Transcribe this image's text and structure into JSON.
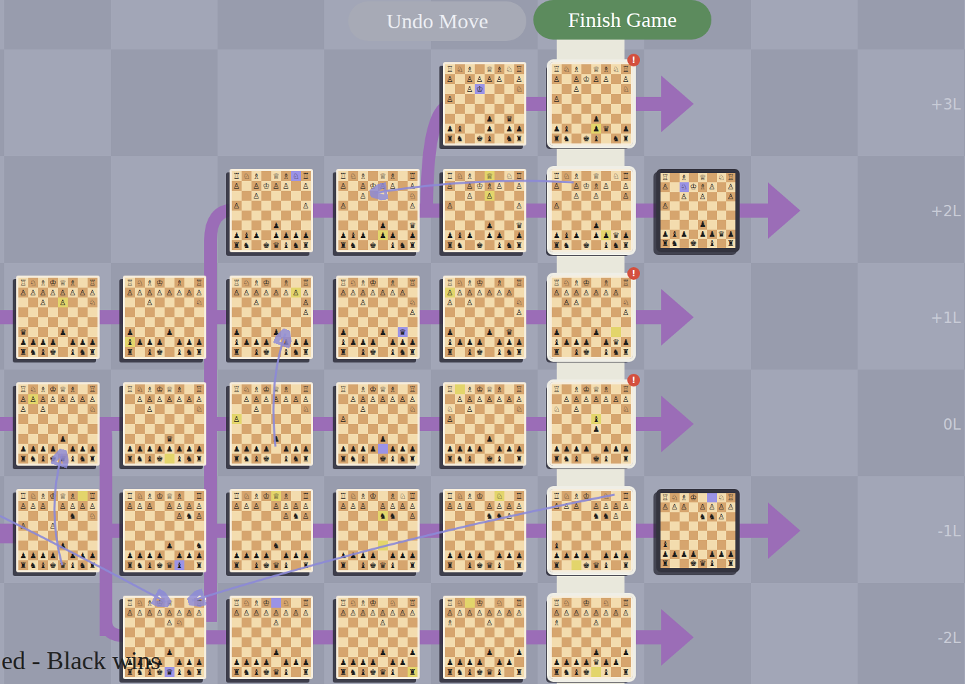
{
  "buttons": [
    {
      "label": "Undo Move",
      "disabled": true
    },
    {
      "label": "Finish Game",
      "disabled": false
    }
  ],
  "result": "ed - Black wins",
  "alert_glyph": "!",
  "timelines": [
    {
      "label": "+3L",
      "boards": [
        null,
        null,
        null,
        null,
        {
          "side": "white",
          "present": false,
          "alert": false,
          "rows": [
            "♖♘♗ ♕♗♘♖",
            "♙ ♙♙♙♙ ♙",
            "  ♙♔   ♘",
            "♙       ",
            "        ",
            "    ♟ ♛ ",
            "♟♝  ♟ ♟♟",
            "♜♞ ♚♝ ♞♜"
          ],
          "marks": [
            {
              "square": [
                2,
                3
              ],
              "color": "#9b93e6"
            }
          ]
        },
        {
          "side": "white",
          "present": true,
          "alert": true,
          "rows": [
            "♖♘♗ ♕♗♘♖",
            "♙ ♙♔♙♙ ♙",
            "  ♙    ♘",
            "♙       ",
            "        ",
            "    ♟   ",
            "♟♝  ♟♛ ♟",
            "♜♞ ♚♝ ♞♜"
          ],
          "marks": [
            {
              "square": [
                6,
                4
              ],
              "color": "#e3d56b"
            }
          ]
        }
      ]
    },
    {
      "label": "+2L",
      "boards": [
        null,
        null,
        {
          "side": "white",
          "present": false,
          "alert": false,
          "rows": [
            "♖♘♗ ♕♗♘♖",
            "♙ ♙♔♙♙ ♙",
            "  ♙     ",
            "♙      ♙",
            "        ",
            "    ♟   ",
            "♟♝♟ ♟♟♟♟",
            "♜♞ ♚♛♝♞♜"
          ],
          "marks": [
            {
              "square": [
                0,
                6
              ],
              "color": "#9b93e6"
            }
          ]
        },
        {
          "side": "white",
          "present": false,
          "alert": false,
          "rows": [
            "♖♘♗ ♕♗ ♖",
            "♙ ♙♔♙♙ ♙",
            "  ♙    ♘",
            "♙      ♙",
            "        ",
            "    ♟  ♛",
            "♟♝♟ ♟♟ ♟",
            "♜♞ ♚ ♝♞♜"
          ],
          "marks": [
            {
              "square": [
                6,
                4
              ],
              "color": "#e3d56b"
            }
          ]
        },
        {
          "side": "white",
          "present": false,
          "alert": false,
          "rows": [
            "♖♘♗ ♕ ♘♖",
            "♙ ♙♔♗♙ ♙",
            "  ♙ ♙   ",
            "♙      ♙",
            "        ",
            "    ♟  ♛",
            "♟♝♟ ♟♟ ♟",
            "♜♞ ♚ ♝♞♜"
          ],
          "marks": [
            {
              "square": [
                0,
                4
              ],
              "color": "#e3d56b"
            },
            {
              "square": [
                2,
                4
              ],
              "color": "#e3d56b"
            }
          ]
        },
        {
          "side": "white",
          "present": true,
          "alert": false,
          "rows": [
            "♖♘♗ ♕ ♘♖",
            "♙ ♙♔♗♙ ♙",
            "  ♙ ♙  ♙",
            "♙       ",
            "        ",
            "    ♟   ",
            "♟♝♟ ♟♟♛♟",
            "♜♞ ♚ ♝♞♜"
          ],
          "marks": [
            {
              "square": [
                6,
                5
              ],
              "color": "#e3d56b"
            }
          ]
        },
        {
          "side": "black",
          "present": false,
          "alert": false,
          "rows": [
            "♖ ♗ ♕ ♘♖",
            "♙ ♘♔♗♙ ♙",
            "  ♙ ♙  ♙",
            "♙       ",
            "        ",
            "    ♟   ",
            "♟♝♟ ♟♟♛♟",
            "♜♞ ♚ ♝ ♜"
          ],
          "marks": [
            {
              "square": [
                1,
                2
              ],
              "color": "#9b93e6"
            }
          ]
        }
      ]
    },
    {
      "label": "+1L",
      "boards": [
        {
          "side": "white",
          "present": false,
          "alert": false,
          "rows": [
            "♖♘♗♔♕♗ ♖",
            "♙♙♙♙♙♙♙♙",
            "  ♙ ♙  ♘",
            "        ",
            "        ",
            "♛   ♟   ",
            "♟♟♟♟ ♟♟♟",
            "♜♞♝♚ ♝♞♜"
          ],
          "marks": [
            {
              "square": [
                2,
                4
              ],
              "color": "#e3d56b"
            }
          ]
        },
        {
          "side": "white",
          "present": false,
          "alert": false,
          "rows": [
            "♖♘♗♔ ♗ ♖",
            "♙♙♙♙♙♙♙♙",
            "  ♙    ♘",
            "        ",
            "        ",
            "♟   ♟   ",
            "♝♟♟♟ ♟♟♟",
            "♜ ♝♚ ♝♞♜"
          ],
          "marks": [
            {
              "square": [
                6,
                0
              ],
              "color": "#e3d56b"
            }
          ]
        },
        {
          "side": "white",
          "present": false,
          "alert": false,
          "rows": [
            "♖♘♗♔ ♗ ♖",
            "♙♙♙♙♙♙♙♙",
            "  ♙    ♙",
            "       ♙",
            "        ",
            "♟   ♟   ",
            "♝♟♟♟ ♟♟♟",
            "♜ ♝♚ ♝♞♜"
          ],
          "marks": [
            {
              "square": [
                1,
                6
              ],
              "color": "#e3d56b"
            }
          ]
        },
        {
          "side": "white",
          "present": false,
          "alert": false,
          "rows": [
            "♖♘♗♔ ♗ ♖",
            "♙♙♙♙♙♙♙ ",
            "  ♙    ♘",
            "       ♙",
            "        ",
            "♟   ♟ ♛ ",
            "♝♟♟♟ ♟♟♟",
            "♜ ♝♚ ♝♞♜"
          ],
          "marks": [
            {
              "square": [
                5,
                6
              ],
              "color": "#9b93e6"
            }
          ]
        },
        {
          "side": "white",
          "present": false,
          "alert": false,
          "rows": [
            "♖♘♗♔ ♗ ♖",
            "♙♙♙♙♙♙♙ ",
            "♙ ♙    ♘",
            "       ♙",
            "        ",
            "♟   ♟ ♛ ",
            "♝♟♟♟ ♟♟♟",
            "♜ ♝♚ ♝♞♜"
          ],
          "marks": [
            {
              "square": [
                1,
                0
              ],
              "color": "#e3d56b"
            }
          ]
        },
        {
          "side": "white",
          "present": true,
          "alert": true,
          "rows": [
            "♖♘♗♔ ♗ ♖",
            "♙♙♙♙♙♙♙ ",
            " ♙♙    ♘",
            "       ♙",
            "        ",
            "♟   ♟   ",
            "♝♟♟♟ ♟♛♟",
            "♜ ♝♚ ♝♞♜"
          ],
          "marks": [
            {
              "square": [
                5,
                6
              ],
              "color": "#e3d56b"
            }
          ]
        }
      ]
    },
    {
      "label": "0L",
      "boards": [
        {
          "side": "white",
          "present": false,
          "alert": false,
          "rows": [
            "♖♘♗♔♕♗ ♖",
            "♙♙♙♙♙♙♙♙",
            "♙ ♙    ♘",
            "        ",
            "        ",
            "    ♟   ",
            "♟♟♟♟ ♟♟♟",
            "♜♞♝♚♛♝♞♜"
          ],
          "marks": [
            {
              "square": [
                1,
                1
              ],
              "color": "#e3d56b"
            }
          ]
        },
        {
          "side": "white",
          "present": false,
          "alert": false,
          "rows": [
            "♖♘♗♔♕♗ ♖",
            " ♙♙♙♙♙♙♙",
            "  ♙    ♘",
            "        ",
            "        ",
            "    ♛   ",
            "♟♟♟♟♟♟♟♟",
            "♜♞♝♚ ♝♞♜"
          ],
          "marks": [
            {
              "square": [
                7,
                4
              ],
              "color": "#e3d56b"
            }
          ]
        },
        {
          "side": "white",
          "present": false,
          "alert": false,
          "rows": [
            "♖♘♗♔♕♗ ♖",
            " ♙♙♙♙♙♙♙",
            "  ♙    ♘",
            "♙       ",
            "        ",
            "    ♟   ",
            "♟♟♟♟ ♟♟♟",
            "♜♞♝♚ ♝♞♜"
          ],
          "marks": [
            {
              "square": [
                3,
                0
              ],
              "color": "#e3d56b"
            }
          ]
        },
        {
          "side": "white",
          "present": false,
          "alert": false,
          "rows": [
            "♖ ♗♔♕♗ ♖",
            " ♙♙♙♙♙♙♙",
            "  ♙    ♘",
            "♙       ",
            "        ",
            "    ♟   ",
            "♟♟♟♟ ♟♟♟",
            "♜♞♝ ♚♝♞♜"
          ],
          "marks": [
            {
              "square": [
                6,
                4
              ],
              "color": "#9b93e6"
            }
          ]
        },
        {
          "side": "white",
          "present": false,
          "alert": false,
          "rows": [
            "♖ ♗♔♕♗ ♖",
            " ♙♙♙♙♙♙♙",
            "♘ ♙    ♘",
            "♙       ",
            "        ",
            "    ♟   ",
            "♟♟♟♟ ♟♟♟",
            "♜♞♝ ♚♝ ♜"
          ],
          "marks": [
            {
              "square": [
                0,
                1
              ],
              "color": "#e3d56b"
            }
          ]
        },
        {
          "side": "white",
          "present": true,
          "alert": true,
          "rows": [
            "♖ ♗♔♕♗ ♖",
            " ♙♙♙♙♙♙♙",
            "♘ ♙    ♘",
            "    ♝   ",
            "    ♟   ",
            "        ",
            "♟♟♟♟ ♟♟♟",
            "♜♞♝ ♚♝ ♜"
          ],
          "marks": [
            {
              "square": [
                3,
                4
              ],
              "color": "#e3d56b"
            }
          ]
        }
      ]
    },
    {
      "label": "-1L",
      "boards": [
        {
          "side": "white",
          "present": false,
          "alert": false,
          "rows": [
            "♖♘♗♔♕♗ ♖",
            "♙♙♙ ♙♙♙♙",
            "     ♞ ♘",
            "♙  ♙    ",
            "        ",
            "    ♟   ",
            "♟♟♟♟ ♟♟♟",
            "♜♞♝♚♛♝♞♜"
          ],
          "marks": [
            {
              "square": [
                0,
                6
              ],
              "color": "#e3d56b"
            }
          ]
        },
        {
          "side": "white",
          "present": false,
          "alert": false,
          "rows": [
            "♖♘♗♔♕♗ ♖",
            "♙♙♙ ♙♙♙♙",
            "     ♙♞♙",
            "        ",
            "        ",
            "    ♟  ♞",
            "♟♟♟♟ ♟♟♟",
            "♜♞♝♚♛♝ ♜"
          ],
          "marks": [
            {
              "square": [
                7,
                5
              ],
              "color": "#9b93e6"
            }
          ]
        },
        {
          "side": "white",
          "present": false,
          "alert": false,
          "rows": [
            "♖♘♗♔♕♗ ♖",
            "♙♙♙ ♙♙♙♙",
            "     ♙♞♙",
            "        ",
            "        ",
            "    ♞   ",
            "♟♟♟♟ ♟♟♟",
            "♜ ♝♚♛♝ ♜"
          ],
          "marks": [
            {
              "square": [
                0,
                4
              ],
              "color": "#e3d56b"
            }
          ]
        },
        {
          "side": "white",
          "present": false,
          "alert": false,
          "rows": [
            "♖♘♗♔ ♗♘♖",
            "♙♙♙ ♙♙♙♙",
            "    ♞♞ ♙",
            "        ",
            "        ",
            "        ",
            "♟♟♟♟ ♟♟♟",
            "♜ ♝♚♛♝ ♜"
          ],
          "marks": [
            {
              "square": [
                2,
                4
              ],
              "color": "#e3d56b"
            },
            {
              "square": [
                5,
                4
              ],
              "color": "#e3d56b"
            }
          ]
        },
        {
          "side": "white",
          "present": false,
          "alert": false,
          "rows": [
            "♖♘♗♔ ♘ ♖",
            "♙♙♙ ♙♙♙♙",
            "    ♞♞♙ ",
            "        ",
            "        ",
            "        ",
            "♟♟♟♟ ♟♟♟",
            "♜ ♝♚♛♝ ♜"
          ],
          "marks": [
            {
              "square": [
                0,
                5
              ],
              "color": "#e3d56b"
            }
          ]
        },
        {
          "side": "white",
          "present": true,
          "alert": false,
          "rows": [
            "♖♘♗♔ ♘ ♖",
            "♙♙♙ ♙♙♙♙",
            "    ♞♞♙ ",
            "        ",
            "        ",
            "♝       ",
            "♟♟♟♟ ♟♟♟",
            "♜  ♚♛♝ ♜"
          ],
          "marks": [
            {
              "square": [
                7,
                2
              ],
              "color": "#e3d56b"
            }
          ]
        },
        {
          "side": "black",
          "present": false,
          "alert": false,
          "rows": [
            "♖♘♗♔  ♘♖",
            "♙♙♙ ♙♙♙♙",
            "    ♞♞♙ ",
            "        ",
            "        ",
            "♝       ",
            "♟♟♟♟ ♟♟♟",
            "♜  ♚♛♝ ♜"
          ],
          "marks": [
            {
              "square": [
                0,
                5
              ],
              "color": "#9b93e6"
            }
          ]
        }
      ]
    },
    {
      "label": "-2L",
      "boards": [
        null,
        {
          "side": "white",
          "present": false,
          "alert": false,
          "rows": [
            "♖♘♗♔♕  ♖",
            "♙♙♙♙♙♙♙♙",
            "    ♙♘  ",
            "        ",
            "        ",
            "    ♟   ",
            "♟♟♟♟ ♟♟♟",
            "♜♞♝♚♛♝♞♜"
          ],
          "marks": [
            {
              "square": [
                7,
                4
              ],
              "color": "#9b93e6"
            }
          ]
        },
        {
          "side": "white",
          "present": false,
          "alert": false,
          "rows": [
            "♖♘♗♔ ♘ ♖",
            "♙♙♙♙♙♙♙♙",
            "    ♙   ",
            "        ",
            "        ",
            "    ♟   ",
            "♟♟♟♟ ♟♟♟",
            "♜♞♝♚♛♝ ♜"
          ],
          "marks": [
            {
              "square": [
                0,
                4
              ],
              "color": "#9b93e6"
            }
          ]
        },
        {
          "side": "white",
          "present": false,
          "alert": false,
          "rows": [
            "♖♘♗♔ ♘ ♖",
            "♙♙♙♙♙♙♙♙",
            "    ♙   ",
            "        ",
            "        ",
            "    ♟  ♟",
            "♟♟♟♟ ♟♟ ",
            "♜♞♝♚♛♝ ♜"
          ],
          "marks": [
            {
              "square": [
                7,
                7
              ],
              "color": "#e3d56b"
            }
          ]
        },
        {
          "side": "white",
          "present": false,
          "alert": false,
          "rows": [
            "♖♘ ♔ ♘ ♖",
            "♙♙♙♙♙♙♙♙",
            "♗   ♙   ",
            "        ",
            "        ",
            "    ♟  ♟",
            "♟♟♟♟ ♟♟ ",
            "♜♞♝♚♛♝ ♜"
          ],
          "marks": [
            {
              "square": [
                0,
                2
              ],
              "color": "#e3d56b"
            }
          ]
        },
        {
          "side": "white",
          "present": true,
          "alert": false,
          "rows": [
            "♖♘ ♔ ♘ ♖",
            "♙♙♙♙♙♙♙♙",
            "♗   ♙   ",
            "        ",
            "        ",
            "    ♟  ♟",
            "♟♟♟♟♛♟♟ ",
            "♜♞♝♚ ♝ ♜"
          ],
          "marks": [
            {
              "square": [
                7,
                4
              ],
              "color": "#e3d56b"
            }
          ]
        }
      ]
    }
  ]
}
